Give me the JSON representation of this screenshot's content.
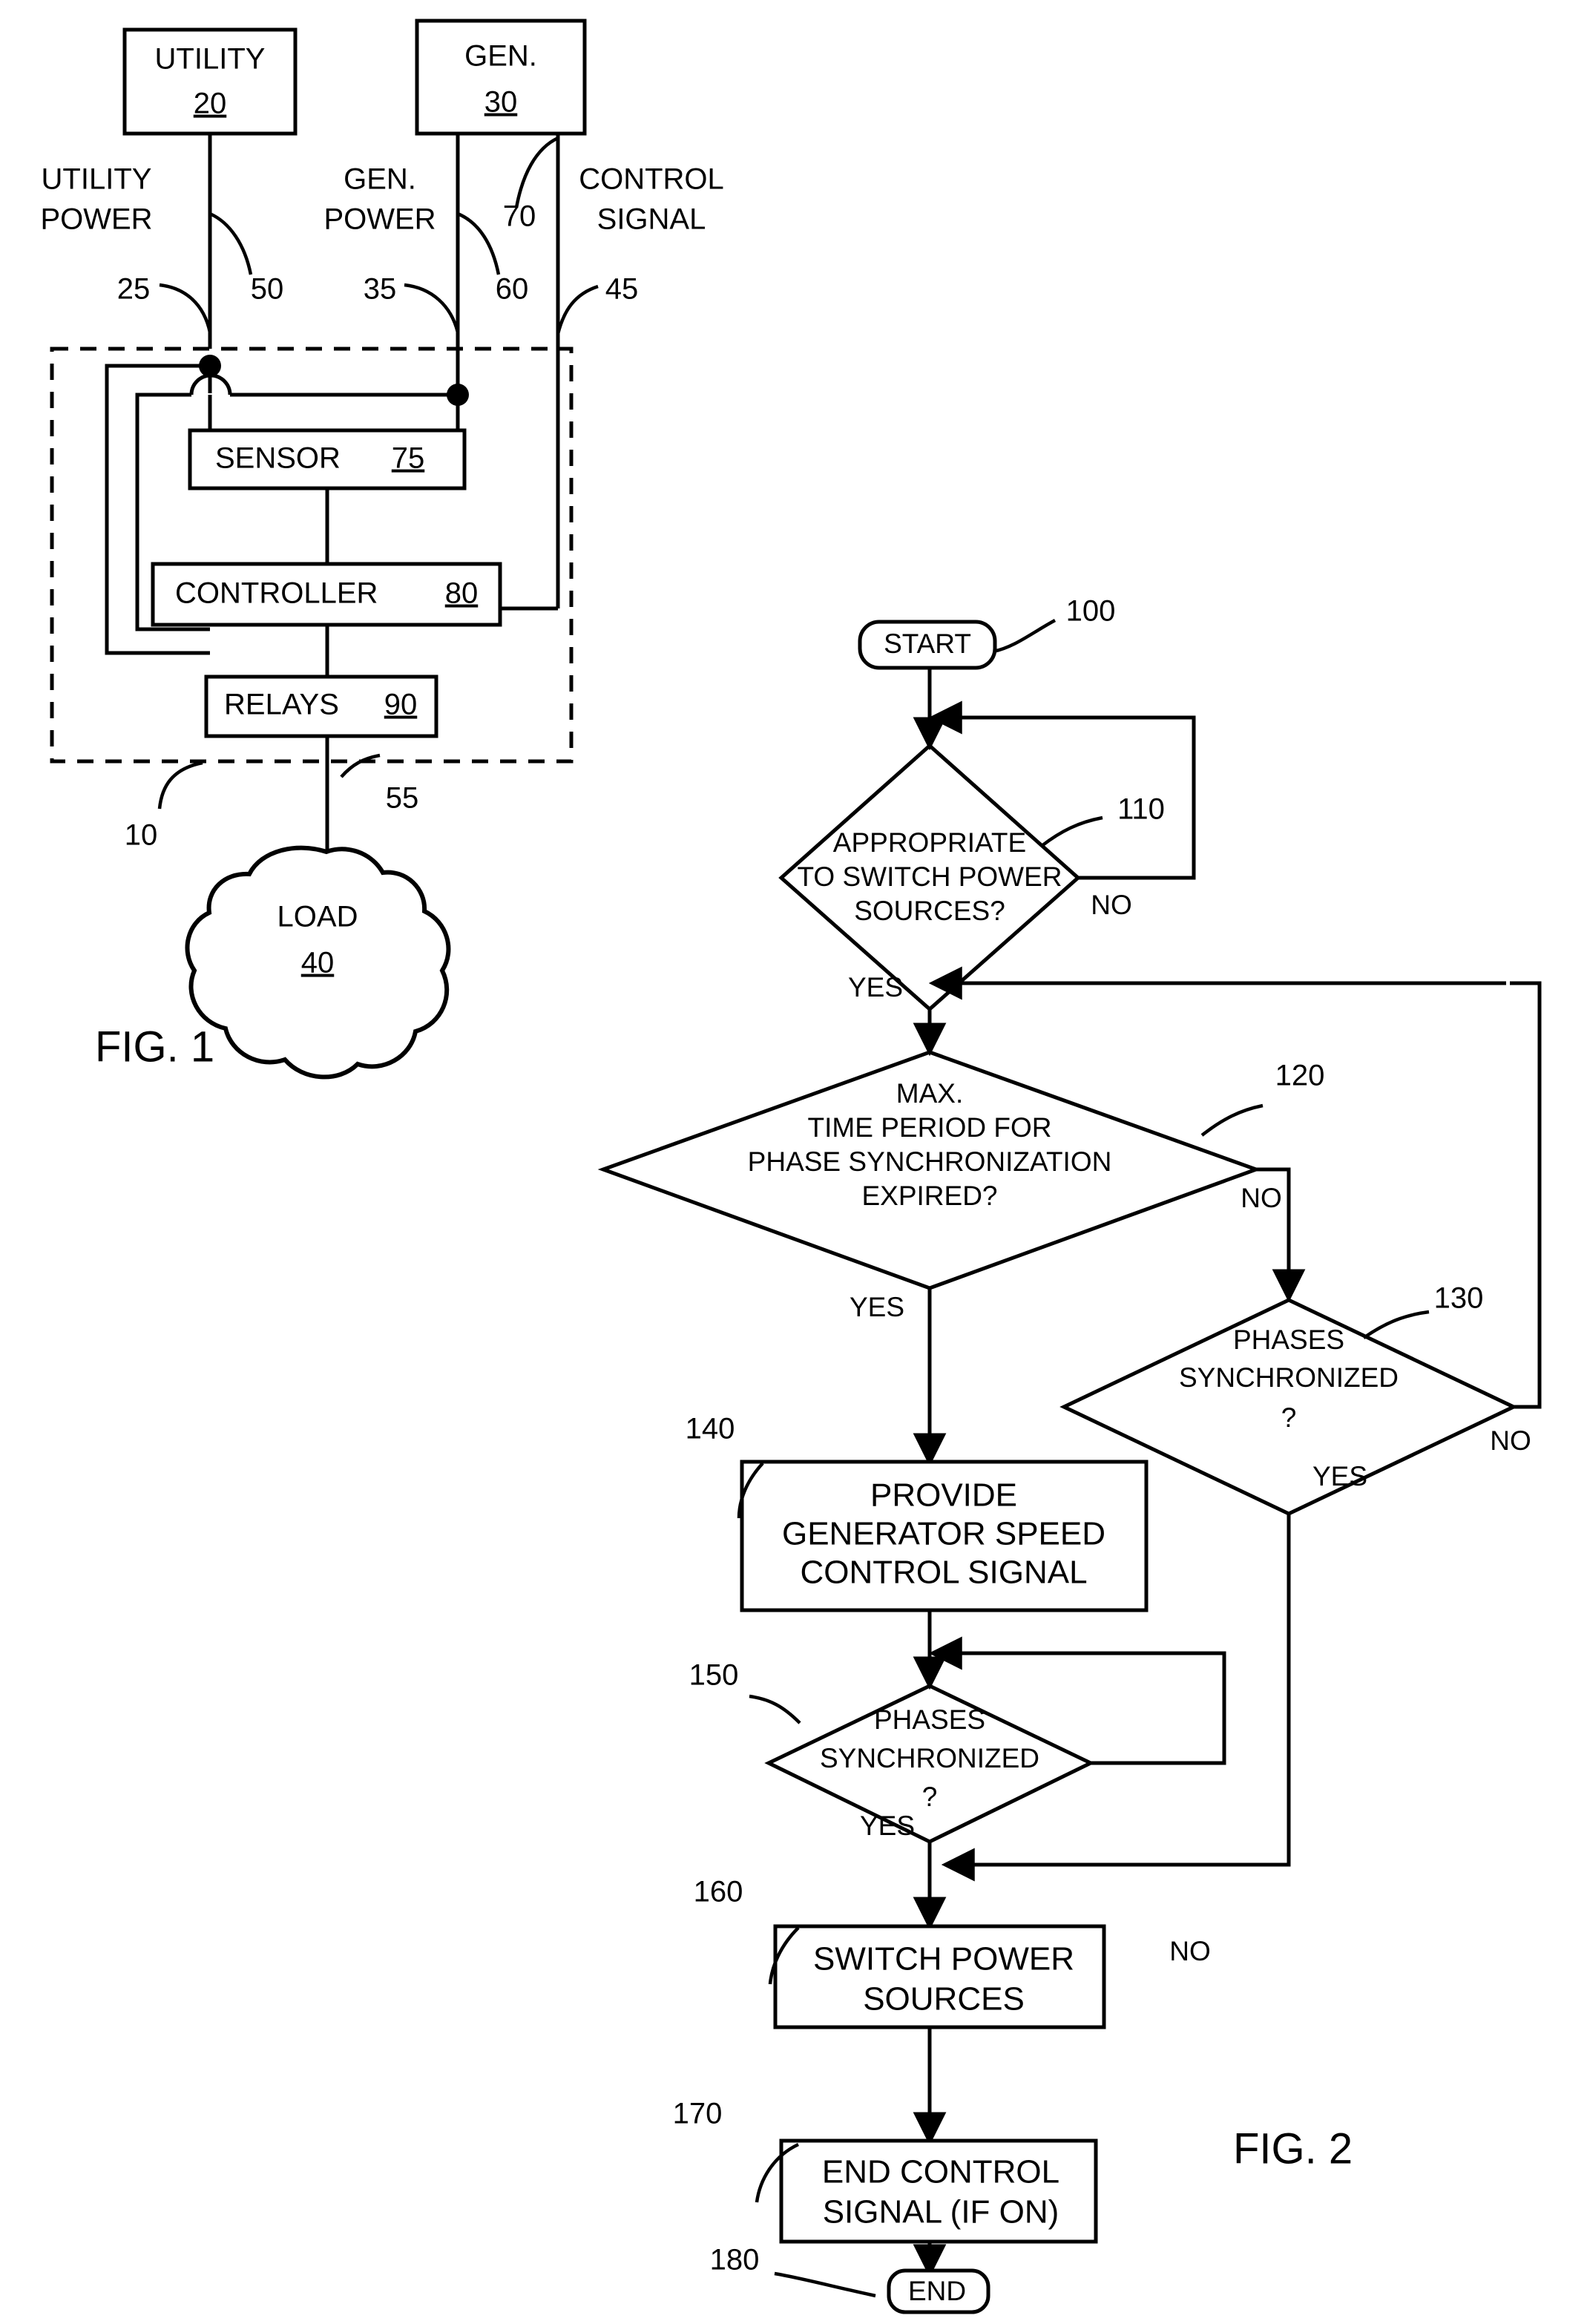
{
  "figure1": {
    "caption": "FIG. 1",
    "blocks": [
      {
        "id": "utility",
        "label": "UTILITY",
        "ref": "20"
      },
      {
        "id": "gen",
        "label": "GEN.",
        "ref": "30"
      },
      {
        "id": "sensor",
        "label": "SENSOR",
        "ref": "75"
      },
      {
        "id": "controller",
        "label": "CONTROLLER",
        "ref": "80"
      },
      {
        "id": "relays",
        "label": "RELAYS",
        "ref": "90"
      },
      {
        "id": "load",
        "label": "LOAD",
        "ref": "40"
      }
    ],
    "line_labels": [
      {
        "id": "utility-power",
        "line1": "UTILITY",
        "line2": "POWER"
      },
      {
        "id": "gen-power",
        "line1": "GEN.",
        "line2": "POWER"
      },
      {
        "id": "control-signal",
        "line1": "CONTROL",
        "line2": "SIGNAL"
      }
    ],
    "reference_numerals": {
      "utility_box": "20",
      "gen_box": "30",
      "utility_line_left": "25",
      "utility_line_right": "50",
      "gen_line_left": "35",
      "gen_line_right": "60",
      "control_line_inner": "70",
      "control_line_right": "45",
      "sensor": "75",
      "controller": "80",
      "relays": "90",
      "system_enclosure": "10",
      "load_feed": "55",
      "load": "40"
    }
  },
  "figure2": {
    "caption": "FIG. 2",
    "nodes": [
      {
        "id": "start",
        "ref": "100",
        "shape": "terminator",
        "text": "START"
      },
      {
        "id": "d110",
        "ref": "110",
        "shape": "decision",
        "lines": [
          "APPROPRIATE",
          "TO SWITCH POWER",
          "SOURCES?"
        ],
        "yes": "YES",
        "no": "NO"
      },
      {
        "id": "d120",
        "ref": "120",
        "shape": "decision",
        "lines": [
          "MAX.",
          "TIME PERIOD FOR",
          "PHASE SYNCHRONIZATION",
          "EXPIRED?"
        ],
        "yes": "YES",
        "no": "NO"
      },
      {
        "id": "d130",
        "ref": "130",
        "shape": "decision",
        "lines": [
          "PHASES",
          "SYNCHRONIZED",
          "?"
        ],
        "yes": "YES",
        "no": "NO"
      },
      {
        "id": "p140",
        "ref": "140",
        "shape": "process",
        "lines": [
          "PROVIDE",
          "GENERATOR SPEED",
          "CONTROL SIGNAL"
        ]
      },
      {
        "id": "d150",
        "ref": "150",
        "shape": "decision",
        "lines": [
          "PHASES",
          "SYNCHRONIZED",
          "?"
        ],
        "yes": "YES",
        "no": "NO"
      },
      {
        "id": "p160",
        "ref": "160",
        "shape": "process",
        "lines": [
          "SWITCH POWER",
          "SOURCES"
        ]
      },
      {
        "id": "p170",
        "ref": "170",
        "shape": "process",
        "lines": [
          "END CONTROL",
          "SIGNAL (IF ON)"
        ]
      },
      {
        "id": "end",
        "ref": "180",
        "shape": "terminator",
        "text": "END"
      }
    ]
  },
  "colors": {
    "ink": "#000000",
    "paper": "#ffffff"
  }
}
